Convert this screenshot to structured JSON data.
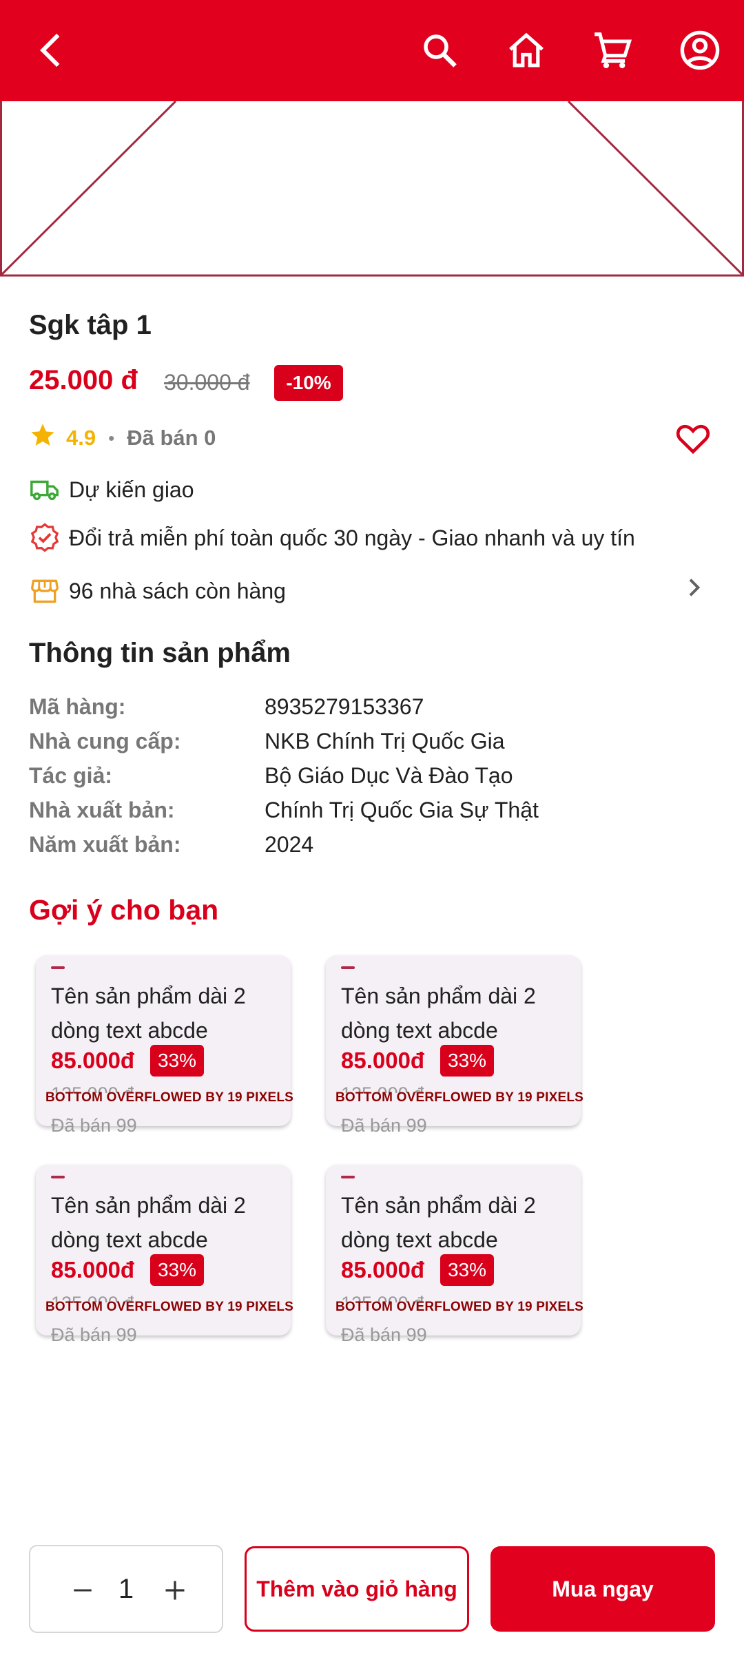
{
  "colors": {
    "brand": "#e1001e",
    "accent": "#d9001b",
    "rating": "#f5b301",
    "delivery": "#3aa935"
  },
  "appbar": {
    "icons": [
      "back-arrow-icon",
      "search-icon",
      "home-icon",
      "cart-icon",
      "account-circle-icon"
    ]
  },
  "product": {
    "title": "Sgk tâp 1",
    "price": "25.000 đ",
    "old_price": "30.000 đ",
    "discount": "-10%",
    "rating": "4.9",
    "separator": "•",
    "sold": "Đã bán 0"
  },
  "info_rows": [
    {
      "icon": "truck-icon",
      "text": "Dự kiến giao"
    },
    {
      "icon": "verified-badge-icon",
      "text": "Đổi trả miễn phí toàn quốc 30 ngày - Giao nhanh và uy tín"
    },
    {
      "icon": "store-icon",
      "text": "96 nhà sách còn hàng"
    }
  ],
  "specs": {
    "title": "Thông tin sản phẩm",
    "rows": [
      {
        "label": "Mã hàng:",
        "value": "8935279153367"
      },
      {
        "label": "Nhà cung cấp:",
        "value": "NKB Chính Trị Quốc Gia"
      },
      {
        "label": "Tác giả:",
        "value": "Bộ Giáo Dục Và Đào Tạo"
      },
      {
        "label": "Nhà xuất bản:",
        "value": "Chính Trị Quốc Gia Sự Thật"
      },
      {
        "label": "Năm xuất bản:",
        "value": "2024"
      }
    ]
  },
  "suggestions": {
    "title": "Gợi ý cho bạn",
    "cards": [
      {
        "name": "Tên sản phẩm dài 2 dòng text abcde",
        "price": "85.000đ",
        "discount": "33%",
        "old_price": "125.000 đ",
        "overflow": "BOTTOM OVERFLOWED BY 19 PIXELS",
        "sold": "Đã bán 99"
      },
      {
        "name": "Tên sản phẩm dài 2 dòng text abcde",
        "price": "85.000đ",
        "discount": "33%",
        "old_price": "125.000 đ",
        "overflow": "BOTTOM OVERFLOWED BY 19 PIXELS",
        "sold": "Đã bán 99"
      },
      {
        "name": "Tên sản phẩm dài 2 dòng text abcde",
        "price": "85.000đ",
        "discount": "33%",
        "old_price": "125.000 đ",
        "overflow": "BOTTOM OVERFLOWED BY 19 PIXELS",
        "sold": "Đã bán 99"
      },
      {
        "name": "Tên sản phẩm dài 2 dòng text abcde",
        "price": "85.000đ",
        "discount": "33%",
        "old_price": "125.000 đ",
        "overflow": "BOTTOM OVERFLOWED BY 19 PIXELS",
        "sold": "Đã bán 99"
      }
    ]
  },
  "bottom_bar": {
    "quantity": "1",
    "add_to_cart": "Thêm vào giỏ hàng",
    "buy_now": "Mua ngay"
  }
}
